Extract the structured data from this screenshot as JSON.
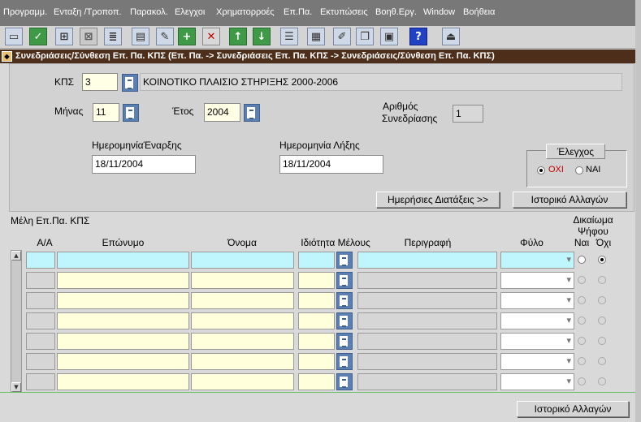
{
  "menubar": {
    "items": [
      "Προγραμμ.",
      "Ενταξη /Τροποπ.",
      "Παρακολ.",
      "Ελεγχοι",
      "Χρηματορροές",
      "Επ.Πα.",
      "Εκτυπώσεις",
      "Βοηθ.Εργ.",
      "Window",
      "Βοήθεια"
    ]
  },
  "toolbar": {
    "help_glyph": "?"
  },
  "titlebar": {
    "title": "Συνεδριάσεις/Σύνθεση Επ. Πα. ΚΠΣ (Επ. Πα. -> Συνεδριάσεις Επ. Πα. ΚΠΣ -> Συνεδριάσεις/Σύνθεση Επ. Πα. ΚΠΣ)"
  },
  "form": {
    "kps_label": "ΚΠΣ",
    "kps_value": "3",
    "kps_desc": "ΚΟΙΝΟΤΙΚΟ ΠΛΑΙΣΙΟ ΣΤΗΡΙΞΗΣ 2000-2006",
    "month_label": "Μήνας",
    "month_value": "11",
    "year_label": "Έτος",
    "year_value": "2004",
    "meeting_no_label_1": "Αριθμός",
    "meeting_no_label_2": "Συνεδρίασης",
    "meeting_no_value": "1",
    "start_date_label": "ΗμερομηνίαΈναρξης",
    "start_date_value": "18/11/2004",
    "end_date_label": "Ημερομηνία Λήξης",
    "end_date_value": "18/11/2004",
    "check_label": "Έλεγχος",
    "check_no": "ΟΧΙ",
    "check_yes": "ΝΑΙ",
    "check_selected": "ΟΧΙ",
    "agenda_button": "Ημερήσιες Διατάξεις >>",
    "history_button": "Ιστορικό Αλλαγών"
  },
  "grid": {
    "section_title": "Μέλη Επ.Πα. ΚΠΣ",
    "headers": {
      "aa": "Α/Α",
      "surname": "Επώνυμο",
      "name": "Όνομα",
      "role": "Ιδιότητα Μέλους",
      "description": "Περιγραφή",
      "gender": "Φύλο",
      "vote_right_1": "Δικαίωμα",
      "vote_right_2": "Ψήφου",
      "yes": "Ναι",
      "no": "Όχι"
    },
    "row_count": 7,
    "selected_vote_first_row": "Όχι"
  },
  "footer": {
    "history_button": "Ιστορικό Αλλαγών"
  }
}
